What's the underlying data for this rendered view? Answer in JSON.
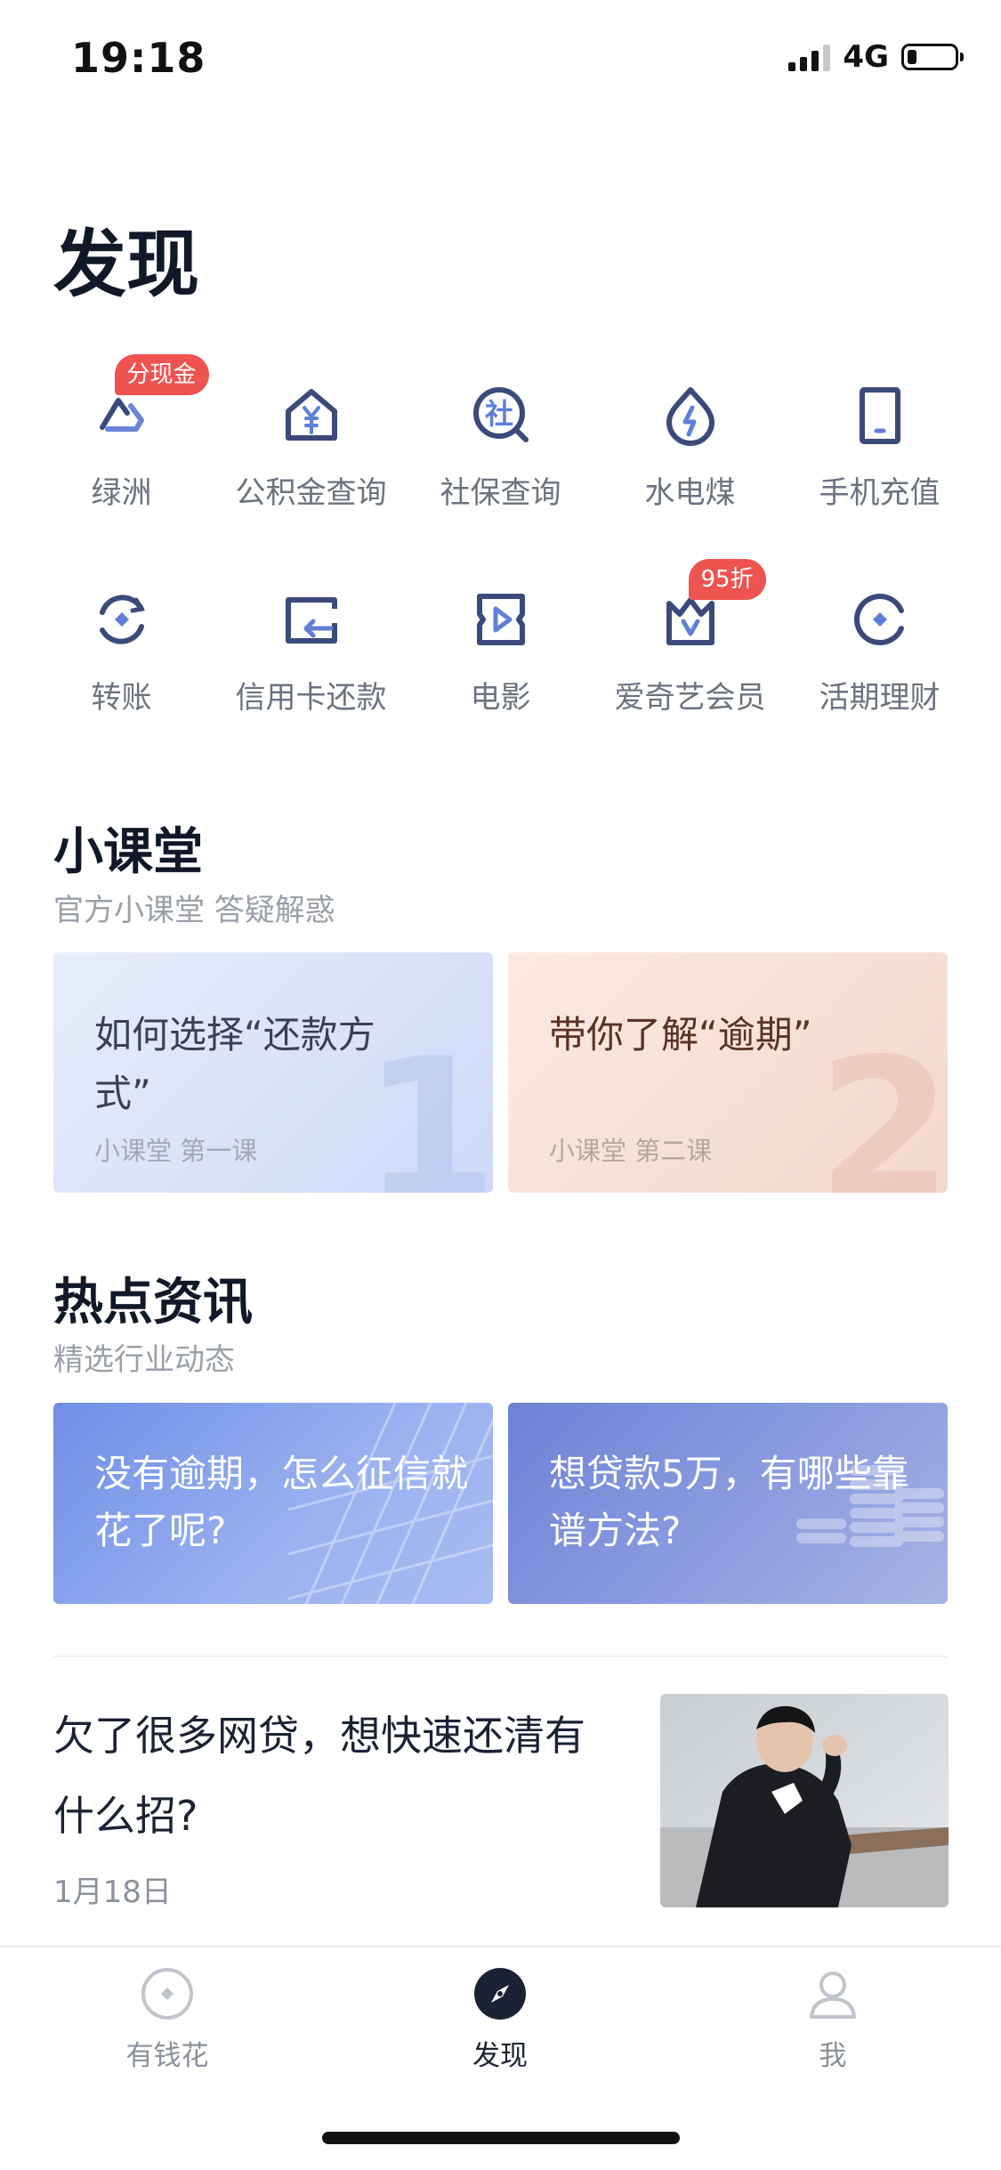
{
  "status_bar": {
    "time": "19:18",
    "network": "4G"
  },
  "page_title": "发现",
  "services": [
    {
      "label": "绿洲",
      "icon": "oasis-icon",
      "badge": "分现金"
    },
    {
      "label": "公积金查询",
      "icon": "housing-fund-icon"
    },
    {
      "label": "社保查询",
      "icon": "social-security-icon"
    },
    {
      "label": "水电煤",
      "icon": "utilities-icon"
    },
    {
      "label": "手机充值",
      "icon": "phone-topup-icon"
    },
    {
      "label": "转账",
      "icon": "transfer-icon"
    },
    {
      "label": "信用卡还款",
      "icon": "credit-card-repay-icon"
    },
    {
      "label": "电影",
      "icon": "movie-icon"
    },
    {
      "label": "爱奇艺会员",
      "icon": "iqiyi-vip-icon",
      "badge": "95折"
    },
    {
      "label": "活期理财",
      "icon": "current-wealth-icon"
    }
  ],
  "classroom": {
    "title": "小课堂",
    "subtitle": "官方小课堂 答疑解惑",
    "cards": [
      {
        "title": "如何选择“还款方式”",
        "meta": "小课堂  第一课",
        "number": "1"
      },
      {
        "title": "带你了解“逾期”",
        "meta": "小课堂  第二课",
        "number": "2"
      }
    ]
  },
  "news": {
    "title": "热点资讯",
    "subtitle": "精选行业动态",
    "cards": [
      {
        "title": "没有逾期，怎么征信就花了呢?"
      },
      {
        "title": "想贷款5万，有哪些靠谱方法?"
      }
    ],
    "article": {
      "title": "欠了很多网贷，想快速还清有什么招?",
      "date": "1月18日"
    }
  },
  "tabbar": [
    {
      "label": "有钱花",
      "icon": "youqianhua-icon"
    },
    {
      "label": "发现",
      "icon": "compass-icon",
      "active": true
    },
    {
      "label": "我",
      "icon": "user-icon"
    }
  ],
  "colors": {
    "accent": "#3f4f8a",
    "badge": "#ef5350",
    "icon": "#3b4a7a"
  }
}
